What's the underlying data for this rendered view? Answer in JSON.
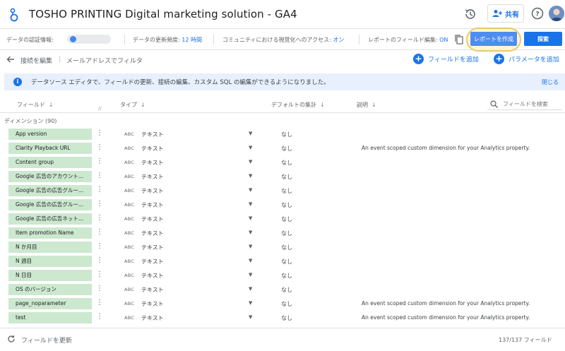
{
  "app": {
    "title": "TOSHO PRINTING Digital marketing solution - GA4",
    "share_label": "共有"
  },
  "infobar": {
    "credentials_label": "データの認証情報:",
    "freshness_label": "データの更新頻度:",
    "freshness_value": "12 時間",
    "community_label": "コミュニティにおける視覚化へのアクセス:",
    "community_value": "オン",
    "field_edit_label": "レポートのフィールド編集:",
    "field_edit_value": "ON",
    "create_report_label": "レポートを作成",
    "search_label": "探索"
  },
  "toolbar": {
    "edit_connection": "接続を編集",
    "filter_by_email": "メールアドレスでフィルタ",
    "add_field": "フィールドを追加",
    "add_parameter": "パラメータを追加"
  },
  "banner": {
    "message": "データソース エディタで、フィールドの更新、接続の編集、カスタム SQL の編集ができるようになりました。",
    "close_label": "閉じる"
  },
  "columns": {
    "field": "フィールド",
    "type": "タイプ",
    "default_agg": "デフォルトの集計",
    "description": "説明",
    "search_placeholder": "フィールドを検索"
  },
  "section": {
    "label": "ディメンション (90)"
  },
  "rows": [
    {
      "name": "App version",
      "abc": "ABC",
      "type": "テキスト",
      "agg": "なし",
      "desc": ""
    },
    {
      "name": "Clarity Playback URL",
      "abc": "ABC",
      "type": "テキスト",
      "agg": "なし",
      "desc": "An event scoped custom dimension for your Analytics property."
    },
    {
      "name": "Content group",
      "abc": "ABC",
      "type": "テキスト",
      "agg": "なし",
      "desc": ""
    },
    {
      "name": "Google 広告のアカウント…",
      "abc": "ABC",
      "type": "テキスト",
      "agg": "なし",
      "desc": ""
    },
    {
      "name": "Google 広告の広告グルー…",
      "abc": "ABC",
      "type": "テキスト",
      "agg": "なし",
      "desc": ""
    },
    {
      "name": "Google 広告の広告グルー…",
      "abc": "ABC",
      "type": "テキスト",
      "agg": "なし",
      "desc": ""
    },
    {
      "name": "Google 広告の広告ネット…",
      "abc": "ABC",
      "type": "テキスト",
      "agg": "なし",
      "desc": ""
    },
    {
      "name": "Item promotion Name",
      "abc": "ABC",
      "type": "テキスト",
      "agg": "なし",
      "desc": ""
    },
    {
      "name": "N か月目",
      "abc": "ABC",
      "type": "テキスト",
      "agg": "なし",
      "desc": ""
    },
    {
      "name": "N 週目",
      "abc": "ABC",
      "type": "テキスト",
      "agg": "なし",
      "desc": ""
    },
    {
      "name": "N 日目",
      "abc": "ABC",
      "type": "テキスト",
      "agg": "なし",
      "desc": ""
    },
    {
      "name": "OS のバージョン",
      "abc": "ABC",
      "type": "テキスト",
      "agg": "なし",
      "desc": ""
    },
    {
      "name": "page_noparameter",
      "abc": "ABC",
      "type": "テキスト",
      "agg": "なし",
      "desc": "An event scoped custom dimension for your Analytics property."
    },
    {
      "name": "test",
      "abc": "ABC",
      "type": "テキスト",
      "agg": "なし",
      "desc": "An event scoped custom dimension for your Analytics property."
    }
  ],
  "footer": {
    "refresh_label": "フィールドを更新",
    "count_label": "137/137 フィールド"
  },
  "colors": {
    "accent": "#1a73e8",
    "field_chip": "#cce8cf",
    "banner_bg": "#e8f0fe",
    "highlight_ring": "#e9c86a"
  }
}
